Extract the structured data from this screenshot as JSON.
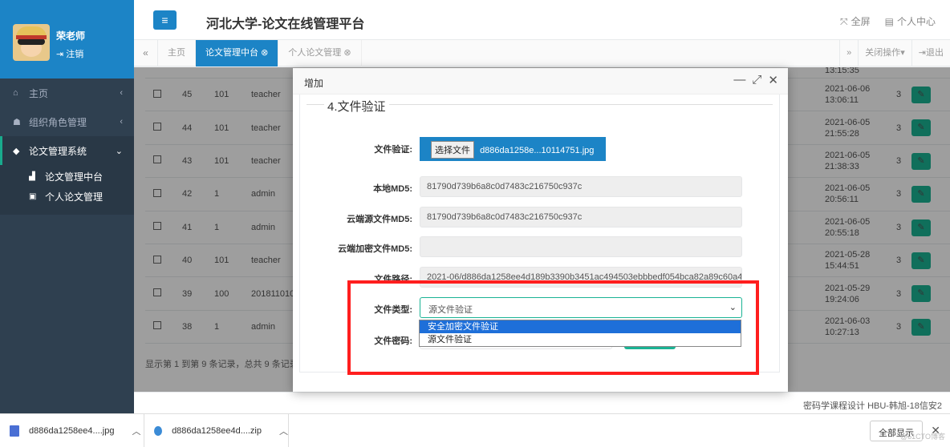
{
  "sidebar": {
    "user_name": "荣老师",
    "logout": "注销",
    "items": [
      {
        "label": "主页"
      },
      {
        "label": "组织角色管理"
      },
      {
        "label": "论文管理系统"
      }
    ],
    "sub_items": [
      {
        "label": "论文管理中台"
      },
      {
        "label": "个人论文管理"
      }
    ]
  },
  "header": {
    "title": "河北大学-论文在线管理平台",
    "fullscreen": "全屏",
    "profile": "个人中心"
  },
  "tabs": {
    "items": [
      {
        "label": "主页"
      },
      {
        "label": "论文管理中台"
      },
      {
        "label": "个人论文管理"
      }
    ],
    "close_ops": "关闭操作",
    "exit": "退出"
  },
  "table": {
    "rows": [
      {
        "id": "45",
        "uid": "101",
        "name": "teacher",
        "date": "2021-06-06",
        "time": "13:06:11",
        "count": "3"
      },
      {
        "id": "44",
        "uid": "101",
        "name": "teacher",
        "date": "2021-06-05",
        "time": "21:55:28",
        "count": "3"
      },
      {
        "id": "43",
        "uid": "101",
        "name": "teacher",
        "date": "2021-06-05",
        "time": "21:38:33",
        "count": "3"
      },
      {
        "id": "42",
        "uid": "1",
        "name": "admin",
        "date": "2021-06-05",
        "time": "20:56:11",
        "count": "3"
      },
      {
        "id": "41",
        "uid": "1",
        "name": "admin",
        "date": "2021-06-05",
        "time": "20:55:18",
        "count": "3"
      },
      {
        "id": "40",
        "uid": "101",
        "name": "teacher",
        "date": "2021-05-28",
        "time": "15:44:51",
        "count": "3"
      },
      {
        "id": "39",
        "uid": "100",
        "name": "2018110105",
        "date": "2021-05-29",
        "time": "19:24:06",
        "count": "3"
      },
      {
        "id": "38",
        "uid": "1",
        "name": "admin",
        "date": "2021-06-03",
        "time": "10:27:13",
        "count": "3"
      }
    ],
    "top_time": "13:15:35",
    "footer": "显示第 1 到第 9 条记录，总共 9 条记录"
  },
  "modal": {
    "title": "增加",
    "section": "4.文件验证",
    "file_label": "文件验证:",
    "file_button": "选择文件",
    "file_name": "d886da1258e...10114751.jpg",
    "local_md5_label": "本地MD5:",
    "local_md5": "81790d739b6a8c0d7483c216750c937c",
    "cloud_md5_label": "云端源文件MD5:",
    "cloud_md5": "81790d739b6a8c0d7483c216750c937c",
    "enc_md5_label": "云端加密文件MD5:",
    "enc_md5": "",
    "path_label": "文件路径:",
    "path": "2021-06/d886da1258ee4d189b3390b3451ac494503ebbbedf054bca82a89c60a4",
    "type_label": "文件类型:",
    "type_value": "源文件验证",
    "type_options": [
      "安全加密文件验证",
      "源文件验证"
    ],
    "password_label": "文件密码:"
  },
  "footer": {
    "text": "密码学课程设计 HBU-韩旭-18信安2"
  },
  "downloads": {
    "items": [
      {
        "name": "d886da1258ee4....jpg"
      },
      {
        "name": "d886da1258ee4d....zip"
      }
    ],
    "show_all": "全部显示",
    "watermark": "@51CTO博客"
  },
  "colors": {
    "primary": "#1c84c6",
    "success": "#1ab394",
    "sidebar": "#2f4050",
    "highlight": "#ff1e1e"
  }
}
